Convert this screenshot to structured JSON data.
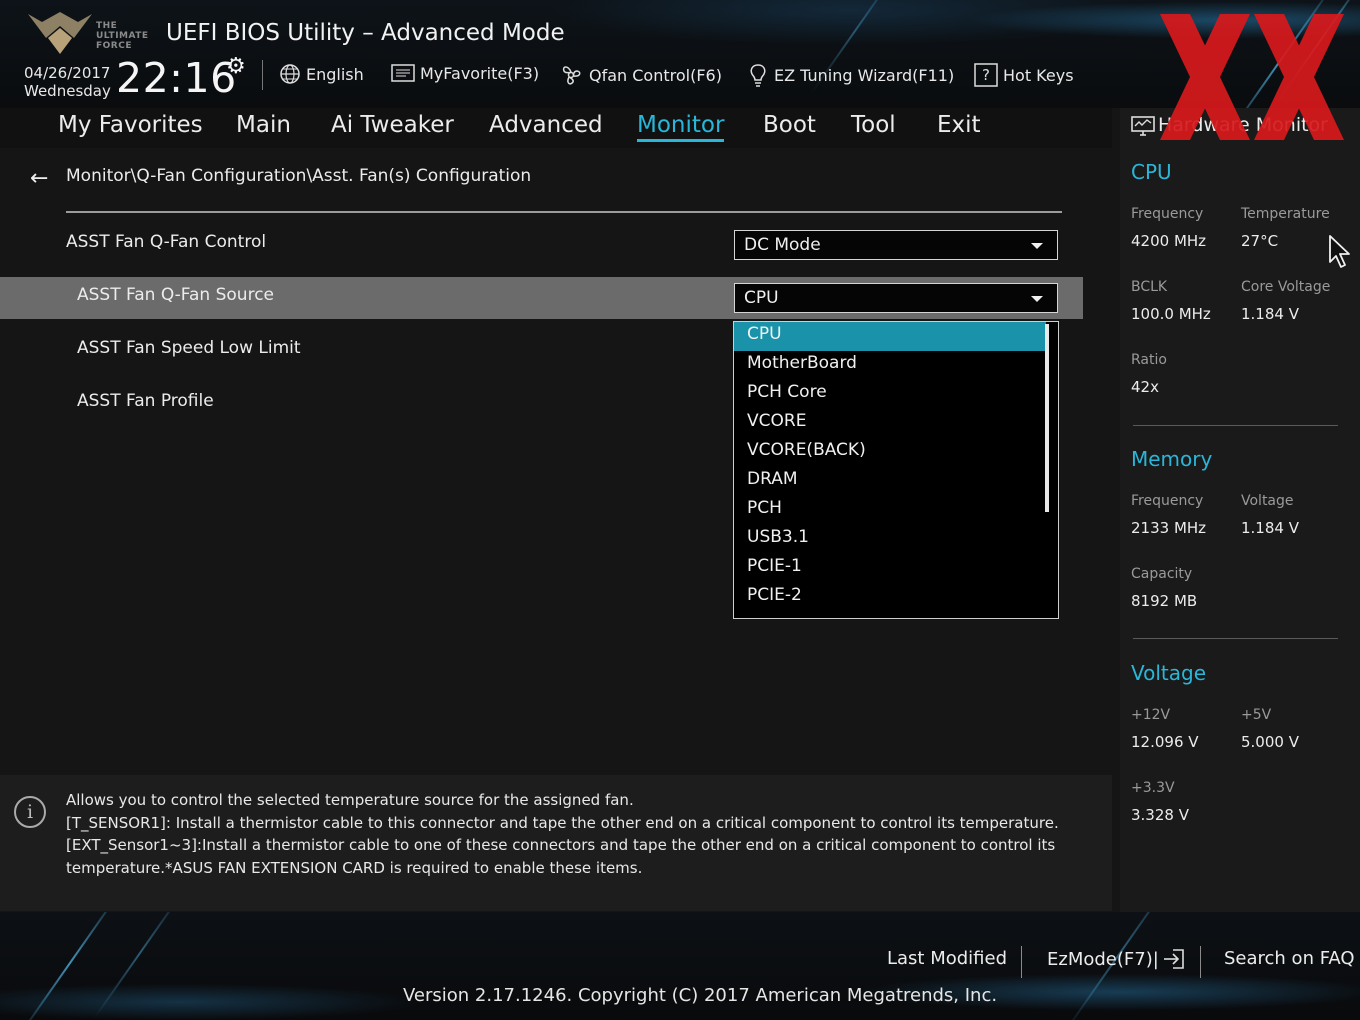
{
  "header": {
    "title": "UEFI BIOS Utility – Advanced Mode",
    "logo_text": "THE ULTIMATE FORCE",
    "date": "04/26/2017",
    "weekday": "Wednesday",
    "time": "22:16",
    "language": "English",
    "myfavorite": "MyFavorite(F3)",
    "qfan": "Qfan Control(F6)",
    "ez_tuning": "EZ Tuning Wizard(F11)",
    "hotkeys": "Hot Keys"
  },
  "menu": {
    "tabs": [
      "My Favorites",
      "Main",
      "Ai Tweaker",
      "Advanced",
      "Monitor",
      "Boot",
      "Tool",
      "Exit"
    ],
    "active": "Monitor"
  },
  "main": {
    "breadcrumb": "Monitor\\Q-Fan Configuration\\Asst. Fan(s) Configuration",
    "rows": [
      {
        "label": "ASST Fan Q-Fan Control",
        "value": "DC Mode"
      },
      {
        "label": "ASST Fan Q-Fan Source",
        "value": "CPU"
      },
      {
        "label": "ASST Fan Speed Low Limit"
      },
      {
        "label": "ASST Fan Profile"
      }
    ],
    "dropdown": {
      "selected": "CPU",
      "options": [
        "CPU",
        "MotherBoard",
        "PCH Core",
        "VCORE",
        "VCORE(BACK)",
        "DRAM",
        "PCH",
        "USB3.1",
        "PCIE-1",
        "PCIE-2"
      ]
    }
  },
  "info": {
    "lines": [
      "Allows you to control the selected temperature source for the assigned fan.",
      "[T_SENSOR1]: Install a thermistor cable to this connector and tape the other end on a critical component to control its temperature.",
      "[EXT_Sensor1~3]:Install a thermistor cable to one of these connectors and tape the other end on a critical component to control its",
      "temperature.*ASUS FAN EXTENSION CARD is required to enable these items."
    ]
  },
  "hw_monitor": {
    "title": "Hardware Monitor",
    "cpu": {
      "heading": "CPU",
      "frequency_label": "Frequency",
      "frequency": "4200 MHz",
      "temperature_label": "Temperature",
      "temperature": "27°C",
      "bclk_label": "BCLK",
      "bclk": "100.0 MHz",
      "core_voltage_label": "Core Voltage",
      "core_voltage": "1.184 V",
      "ratio_label": "Ratio",
      "ratio": "42x"
    },
    "memory": {
      "heading": "Memory",
      "frequency_label": "Frequency",
      "frequency": "2133 MHz",
      "voltage_label": "Voltage",
      "voltage": "1.184 V",
      "capacity_label": "Capacity",
      "capacity": "8192 MB"
    },
    "voltage": {
      "heading": "Voltage",
      "v12_label": "+12V",
      "v12": "12.096 V",
      "v5_label": "+5V",
      "v5": "5.000 V",
      "v33_label": "+3.3V",
      "v33": "3.328 V"
    }
  },
  "footer": {
    "last_modified": "Last Modified",
    "ezmode": "EzMode(F7)|",
    "search_faq": "Search on FAQ",
    "copyright": "Version 2.17.1246. Copyright (C) 2017 American Megatrends, Inc."
  },
  "colors": {
    "accent": "#2ab6d8",
    "selected_option": "#1a93aa",
    "highlight_row": "#6b6b6b",
    "watermark_red": "#d8191c"
  }
}
